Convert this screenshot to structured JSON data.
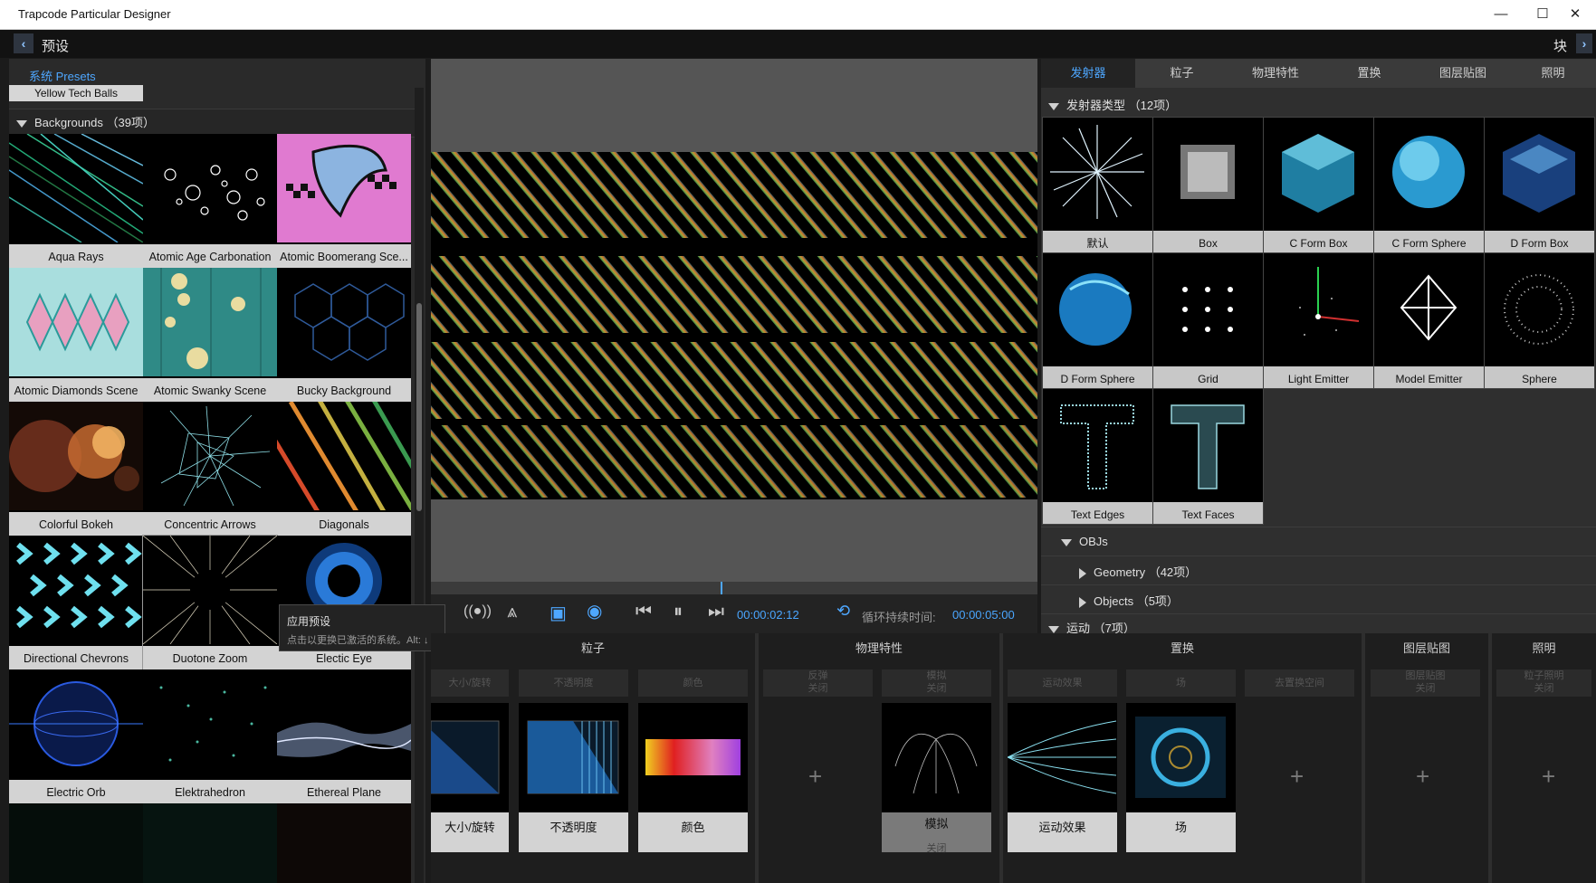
{
  "window": {
    "title": "Trapcode Particular Designer",
    "minimize": "—",
    "maximize": "☐",
    "close": "✕"
  },
  "header": {
    "back": "‹",
    "forward": "›",
    "title": "预设",
    "right_label": "块"
  },
  "presets": {
    "section_label": "系统 Presets",
    "previous_item": "Yellow Tech Balls",
    "group_label": "Backgrounds",
    "group_count": "（39项）",
    "items": [
      {
        "label": "Aqua Rays"
      },
      {
        "label": "Atomic Age Carbonation"
      },
      {
        "label": "Atomic Boomerang Sce..."
      },
      {
        "label": "Atomic Diamonds Scene"
      },
      {
        "label": "Atomic Swanky Scene"
      },
      {
        "label": "Bucky Background"
      },
      {
        "label": "Colorful Bokeh"
      },
      {
        "label": "Concentric Arrows"
      },
      {
        "label": "Diagonals"
      },
      {
        "label": "Directional Chevrons"
      },
      {
        "label": "Duotone Zoom"
      },
      {
        "label": "Electic Eye"
      },
      {
        "label": "Electric Orb"
      },
      {
        "label": "Elektrahedron"
      },
      {
        "label": "Ethereal Plane"
      }
    ]
  },
  "tooltip": {
    "title": "应用预设",
    "text": "点击以更换已激活的系统。Alt: ↓"
  },
  "transport": {
    "time_current": "00:00:02:12",
    "loop_label": "循环持续时间:",
    "loop_duration": "00:00:05:00"
  },
  "right_panel": {
    "tabs": [
      {
        "label": "发射器"
      },
      {
        "label": "粒子"
      },
      {
        "label": "物理特性"
      },
      {
        "label": "置换"
      },
      {
        "label": "图层贴图"
      },
      {
        "label": "照明"
      }
    ],
    "emitter_type_label": "发射器类型",
    "emitter_type_count": "（12项）",
    "emitters": [
      {
        "label": "默认"
      },
      {
        "label": "Box"
      },
      {
        "label": "C Form Box"
      },
      {
        "label": "C Form Sphere"
      },
      {
        "label": "D Form Box"
      },
      {
        "label": "D Form Sphere"
      },
      {
        "label": "Grid"
      },
      {
        "label": "Light Emitter"
      },
      {
        "label": "Model Emitter"
      },
      {
        "label": "Sphere"
      },
      {
        "label": "Text Edges"
      },
      {
        "label": "Text Faces"
      }
    ],
    "objs_label": "OBJs",
    "geometry_label": "Geometry",
    "geometry_count": "（42项）",
    "objects_label": "Objects",
    "objects_count": "（5项）",
    "motion_label": "运动",
    "motion_count": "（7项）"
  },
  "blocks": {
    "particles": {
      "title": "粒子",
      "dim": [
        "大小/旋转",
        "不透明度",
        "颜色"
      ],
      "cards": [
        "大小/旋转",
        "不透明度",
        "颜色"
      ]
    },
    "physics": {
      "title": "物理特性",
      "dim": [
        "反弹\n关闭",
        "模拟\n关闭"
      ],
      "card": "模拟",
      "card_sub": "关闭",
      "plus": "+"
    },
    "displace": {
      "title": "置换",
      "dim": [
        "运动效果",
        "场",
        "去置换空间"
      ],
      "cards": [
        "运动效果",
        "场"
      ],
      "plus": "+"
    },
    "layer_map": {
      "title": "图层贴图",
      "dim": "图层贴图\n关闭",
      "plus": "+"
    },
    "lighting": {
      "title": "照明",
      "dim": "粒子照明\n关闭",
      "plus": "+"
    }
  },
  "colors": {
    "accent": "#4ea7ff",
    "bg": "#1b1b1b",
    "panel": "#2a2a2a"
  }
}
